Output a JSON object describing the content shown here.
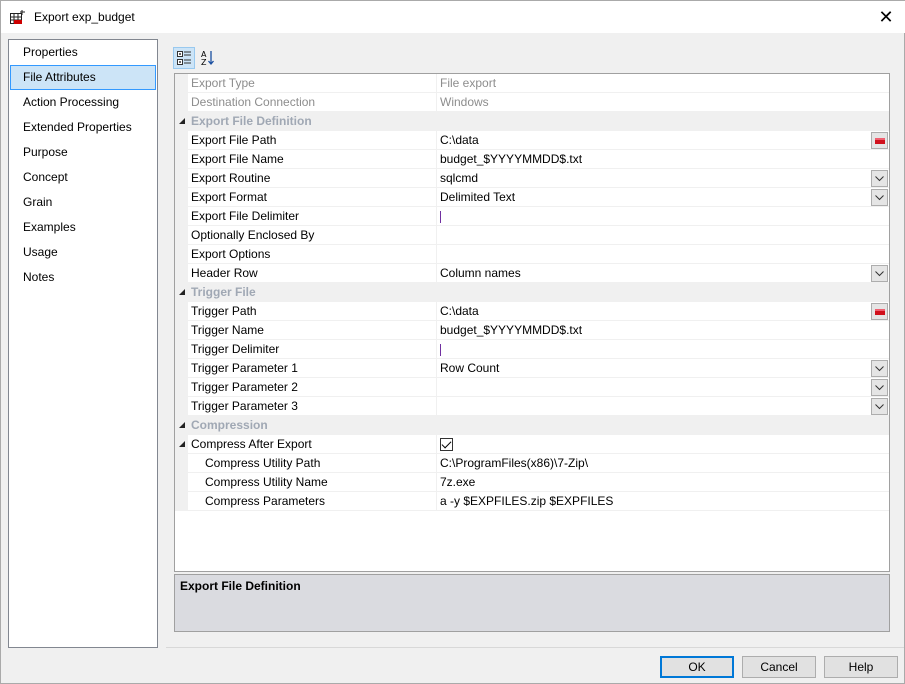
{
  "window": {
    "title": "Export exp_budget",
    "close_label": "✕"
  },
  "nav": {
    "items": [
      "Properties",
      "File Attributes",
      "Action Processing",
      "Extended Properties",
      "Purpose",
      "Concept",
      "Grain",
      "Examples",
      "Usage",
      "Notes"
    ],
    "selected": 1
  },
  "toolbar": {
    "categorized": "categorized-icon",
    "alphabetical": "sort-az-icon"
  },
  "grid": {
    "rows": [
      {
        "type": "dis",
        "name": "Export Type",
        "value": "File export"
      },
      {
        "type": "dis",
        "name": "Destination Connection",
        "value": "Windows"
      },
      {
        "type": "cat",
        "name": "Export File Definition"
      },
      {
        "type": "folder",
        "name": "Export File Path",
        "value": "C:\\data"
      },
      {
        "type": "text",
        "name": "Export File Name",
        "value": "budget_$YYYYMMDD$.txt"
      },
      {
        "type": "dd",
        "name": "Export Routine",
        "value": "sqlcmd"
      },
      {
        "type": "dd",
        "name": "Export Format",
        "value": "Delimited Text"
      },
      {
        "type": "caret",
        "name": "Export File Delimiter",
        "value": ""
      },
      {
        "type": "text",
        "name": "Optionally Enclosed By",
        "value": ""
      },
      {
        "type": "text",
        "name": "Export Options",
        "value": ""
      },
      {
        "type": "dd",
        "name": "Header Row",
        "value": "Column names"
      },
      {
        "type": "cat",
        "name": "Trigger File"
      },
      {
        "type": "folder",
        "name": "Trigger Path",
        "value": "C:\\data"
      },
      {
        "type": "text",
        "name": "Trigger Name",
        "value": "budget_$YYYYMMDD$.txt"
      },
      {
        "type": "caret",
        "name": "Trigger Delimiter",
        "value": ""
      },
      {
        "type": "dd",
        "name": "Trigger Parameter 1",
        "value": "Row Count"
      },
      {
        "type": "dd",
        "name": "Trigger Parameter 2",
        "value": ""
      },
      {
        "type": "dd",
        "name": "Trigger Parameter 3",
        "value": ""
      },
      {
        "type": "cat",
        "name": "Compression"
      },
      {
        "type": "check",
        "name": "Compress After Export",
        "value": "",
        "checked": true,
        "expander": true
      },
      {
        "type": "child",
        "name": "Compress Utility Path",
        "value": "C:\\ProgramFiles(x86)\\7-Zip\\"
      },
      {
        "type": "child",
        "name": "Compress Utility Name",
        "value": "7z.exe"
      },
      {
        "type": "child",
        "name": "Compress Parameters",
        "value": "a -y $EXPFILES.zip $EXPFILES"
      }
    ]
  },
  "description": {
    "title": "Export File Definition"
  },
  "buttons": {
    "ok": "OK",
    "cancel": "Cancel",
    "help": "Help"
  }
}
